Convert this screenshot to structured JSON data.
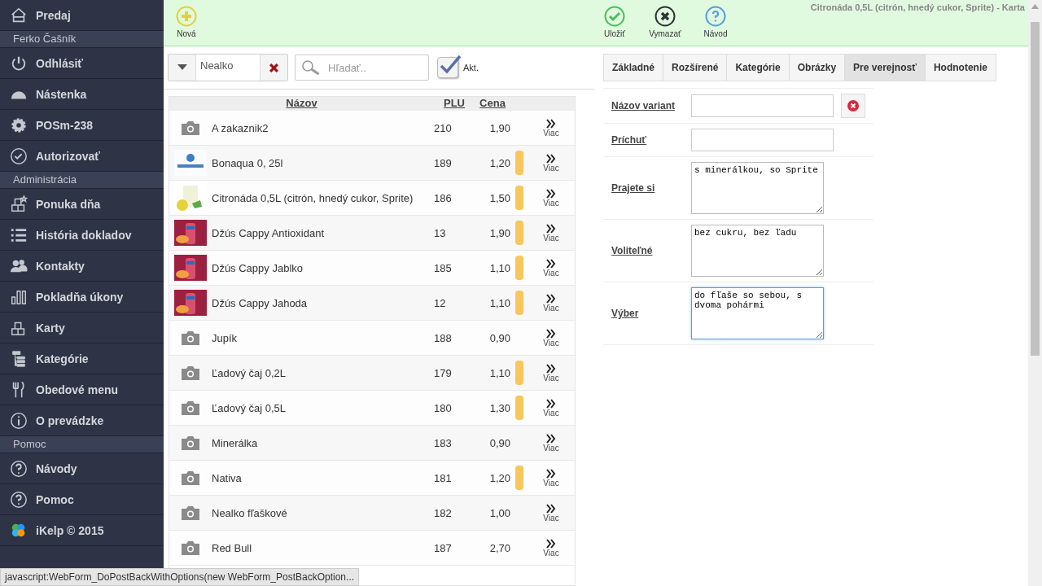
{
  "sidebar": {
    "items": [
      {
        "kind": "item",
        "label": "Predaj"
      },
      {
        "kind": "section",
        "label": "Ferko Čašník"
      },
      {
        "kind": "item",
        "label": "Odhlásiť"
      },
      {
        "kind": "item",
        "label": "Nástenka"
      },
      {
        "kind": "item",
        "label": "POSm-238"
      },
      {
        "kind": "item",
        "label": "Autorizovať"
      },
      {
        "kind": "section",
        "label": "Administrácia"
      },
      {
        "kind": "item",
        "label": "Ponuka dňa"
      },
      {
        "kind": "item",
        "label": "História dokladov"
      },
      {
        "kind": "item",
        "label": "Kontakty"
      },
      {
        "kind": "item",
        "label": "Pokladňa úkony"
      },
      {
        "kind": "item",
        "label": "Karty"
      },
      {
        "kind": "item",
        "label": "Kategórie"
      },
      {
        "kind": "item",
        "label": "Obedové menu"
      },
      {
        "kind": "item",
        "label": "O prevádzke"
      },
      {
        "kind": "section",
        "label": "Pomoc"
      },
      {
        "kind": "item",
        "label": "Návody"
      },
      {
        "kind": "item",
        "label": "Pomoc"
      },
      {
        "kind": "item",
        "label": "iKelp © 2015"
      }
    ]
  },
  "toolbar": {
    "buttons": [
      {
        "label": "Nová"
      },
      {
        "label": "Uložiť"
      },
      {
        "label": "Vymazať"
      },
      {
        "label": "Návod"
      }
    ],
    "title": "Citronáda 0,5L (citrón, hnedý cukor, Sprite) - Karta"
  },
  "filter": {
    "category": "Nealko",
    "search_placeholder": "Hľadať..",
    "active_checked": true,
    "active_label": "Akt."
  },
  "table": {
    "columns": [
      "Názov",
      "PLU",
      "Cena"
    ],
    "rows": [
      {
        "kind": "camera",
        "name": "A zakaznik2",
        "plu": "210",
        "price": "1,90",
        "marked": false,
        "more": "Viac"
      },
      {
        "kind": "picture",
        "name": "Bonaqua 0, 25l",
        "plu": "189",
        "price": "1,20",
        "marked": true,
        "more": "Viac"
      },
      {
        "kind": "picture",
        "name": "Citronáda 0,5L (citrón, hnedý cukor, Sprite)",
        "plu": "186",
        "price": "1,50",
        "marked": true,
        "more": "Viac"
      },
      {
        "kind": "picture",
        "name": "Džús Cappy Antioxidant",
        "plu": "13",
        "price": "1,90",
        "marked": true,
        "more": "Viac"
      },
      {
        "kind": "picture",
        "name": "Džús Cappy Jablko",
        "plu": "185",
        "price": "1,10",
        "marked": true,
        "more": "Viac"
      },
      {
        "kind": "picture",
        "name": "Džús Cappy Jahoda",
        "plu": "12",
        "price": "1,10",
        "marked": true,
        "more": "Viac"
      },
      {
        "kind": "camera",
        "name": "Jupík",
        "plu": "188",
        "price": "0,90",
        "marked": false,
        "more": "Viac"
      },
      {
        "kind": "camera",
        "name": "Ľadový čaj 0,2L",
        "plu": "179",
        "price": "1,10",
        "marked": true,
        "more": "Viac"
      },
      {
        "kind": "camera",
        "name": "Ľadový čaj 0,5L",
        "plu": "180",
        "price": "1,30",
        "marked": true,
        "more": "Viac"
      },
      {
        "kind": "camera",
        "name": "Minerálka",
        "plu": "183",
        "price": "0,90",
        "marked": false,
        "more": "Viac"
      },
      {
        "kind": "camera",
        "name": "Nativa",
        "plu": "181",
        "price": "1,20",
        "marked": true,
        "more": "Viac"
      },
      {
        "kind": "camera",
        "name": "Nealko fľaškové",
        "plu": "182",
        "price": "1,00",
        "marked": false,
        "more": "Viac"
      },
      {
        "kind": "camera",
        "name": "Red Bull",
        "plu": "187",
        "price": "2,70",
        "marked": false,
        "more": "Viac"
      }
    ]
  },
  "tabs": [
    {
      "label": "Základné",
      "selected": false
    },
    {
      "label": "Rozšírené",
      "selected": false
    },
    {
      "label": "Kategórie",
      "selected": false
    },
    {
      "label": "Obrázky",
      "selected": false
    },
    {
      "label": "Pre verejnosť",
      "selected": true
    },
    {
      "label": "Hodnotenie",
      "selected": false
    }
  ],
  "form": {
    "fields": [
      {
        "kind": "input",
        "label": "Názov variant",
        "deletable": true,
        "focused": false
      },
      {
        "kind": "input",
        "label": "Príchuť",
        "deletable": false,
        "focused": false
      },
      {
        "kind": "textarea",
        "label": "Prajete si",
        "value": "s minerálkou, so Sprite",
        "deletable": false,
        "focused": false
      },
      {
        "kind": "textarea",
        "label": "Voliteľné",
        "value": "bez cukru, bez ľadu",
        "deletable": false,
        "focused": false
      },
      {
        "kind": "textarea",
        "label": "Výber",
        "value": "do fľaše so sebou, s dvoma pohármi",
        "deletable": false,
        "focused": true
      }
    ]
  },
  "status_bar": "javascript:WebForm_DoPostBackWithOptions(new WebForm_PostBackOption..."
}
